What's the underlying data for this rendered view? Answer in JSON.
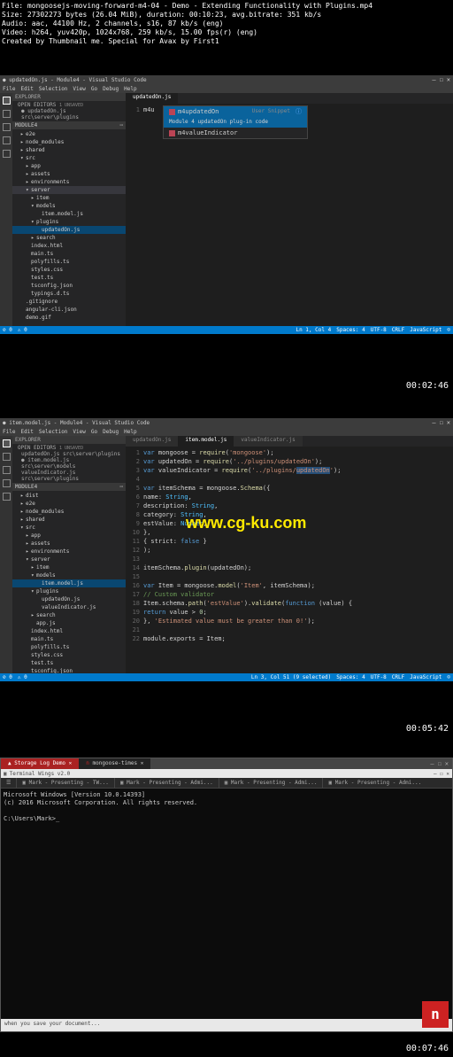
{
  "info": {
    "file": "File: mongoosejs-moving-forward-m4-04 - Demo - Extending Functionality with Plugins.mp4",
    "size": "Size: 27302273 bytes (26.04 MiB), duration: 00:10:23, avg.bitrate: 351 kb/s",
    "audio": "Audio: aac, 44100 Hz, 2 channels, s16, 87 kb/s (eng)",
    "video": "Video: h264, yuv420p, 1024x768, 259 kb/s, 15.00 fps(r) (eng)",
    "created": "Created by Thumbnail me. Special for Avax by First1"
  },
  "watermark": "www.cg-ku.com",
  "ts1": "00:02:46",
  "ts2": "00:05:42",
  "ts3": "00:07:46",
  "vsc1": {
    "title": "● updatedOn.js - Module4 - Visual Studio Code",
    "menu": [
      "File",
      "Edit",
      "Selection",
      "View",
      "Go",
      "Debug",
      "Help"
    ],
    "explorer_title": "EXPLORER",
    "openeditors_title": "OPEN EDITORS",
    "unsaved": "1 UNSAVED",
    "openeditors": [
      "● updatedOn.js src\\server\\plugins"
    ],
    "folder_title": "MODULE4",
    "tree": [
      {
        "l": "e2e",
        "d": 1,
        "exp": false
      },
      {
        "l": "node_modules",
        "d": 1,
        "exp": false
      },
      {
        "l": "shared",
        "d": 1,
        "exp": false
      },
      {
        "l": "src",
        "d": 1,
        "exp": true
      },
      {
        "l": "app",
        "d": 2,
        "exp": false
      },
      {
        "l": "assets",
        "d": 2,
        "exp": false
      },
      {
        "l": "environments",
        "d": 2,
        "exp": false
      },
      {
        "l": "server",
        "d": 2,
        "exp": true,
        "hl": true
      },
      {
        "l": "item",
        "d": 3,
        "exp": false
      },
      {
        "l": "models",
        "d": 3,
        "exp": true
      },
      {
        "l": "item.model.js",
        "d": 4,
        "file": true
      },
      {
        "l": "plugins",
        "d": 3,
        "exp": true
      },
      {
        "l": "updatedOn.js",
        "d": 4,
        "file": true,
        "sel": true
      },
      {
        "l": "search",
        "d": 3,
        "exp": false
      },
      {
        "l": "index.html",
        "d": 2,
        "file": true
      },
      {
        "l": "main.ts",
        "d": 2,
        "file": true
      },
      {
        "l": "polyfills.ts",
        "d": 2,
        "file": true
      },
      {
        "l": "styles.css",
        "d": 2,
        "file": true
      },
      {
        "l": "test.ts",
        "d": 2,
        "file": true
      },
      {
        "l": "tsconfig.json",
        "d": 2,
        "file": true
      },
      {
        "l": "typings.d.ts",
        "d": 2,
        "file": true
      },
      {
        "l": ".gitignore",
        "d": 1,
        "file": true
      },
      {
        "l": "angular-cli.json",
        "d": 1,
        "file": true
      },
      {
        "l": "demo.gif",
        "d": 1,
        "file": true
      }
    ],
    "active_tab": "updatedOn.js",
    "typed": "m4u",
    "suggest": [
      {
        "icon": true,
        "label": "m4updatedOn",
        "type": "User Snippet",
        "sel": true
      },
      {
        "label": "Module 4 updatedOn plug-in code",
        "detail": true
      },
      {
        "icon": true,
        "label": "m4valueIndicator"
      }
    ],
    "status_left": [
      "⊘ 0",
      "⚠ 0"
    ],
    "status_right": [
      "Ln 1, Col 4",
      "Spaces: 4",
      "UTF-8",
      "CRLF",
      "JavaScript",
      "☺"
    ]
  },
  "vsc2": {
    "title": "● item.model.js - Module4 - Visual Studio Code",
    "menu": [
      "File",
      "Edit",
      "Selection",
      "View",
      "Go",
      "Debug",
      "Help"
    ],
    "explorer_title": "EXPLORER",
    "openeditors_title": "OPEN EDITORS",
    "unsaved": "1 UNSAVED",
    "openeditors": [
      "updatedOn.js src\\server\\plugins",
      "● item.model.js src\\server\\models",
      "valueIndicator.js src\\server\\plugins"
    ],
    "folder_title": "MODULE4",
    "tree": [
      {
        "l": "dist",
        "d": 1,
        "exp": false
      },
      {
        "l": "e2e",
        "d": 1,
        "exp": false
      },
      {
        "l": "node_modules",
        "d": 1,
        "exp": false
      },
      {
        "l": "shared",
        "d": 1,
        "exp": false
      },
      {
        "l": "src",
        "d": 1,
        "exp": true
      },
      {
        "l": "app",
        "d": 2,
        "exp": false
      },
      {
        "l": "assets",
        "d": 2,
        "exp": false
      },
      {
        "l": "environments",
        "d": 2,
        "exp": false
      },
      {
        "l": "server",
        "d": 2,
        "exp": true
      },
      {
        "l": "item",
        "d": 3,
        "exp": false
      },
      {
        "l": "models",
        "d": 3,
        "exp": true
      },
      {
        "l": "item.model.js",
        "d": 4,
        "file": true,
        "sel": true
      },
      {
        "l": "plugins",
        "d": 3,
        "exp": true
      },
      {
        "l": "updatedOn.js",
        "d": 4,
        "file": true
      },
      {
        "l": "valueIndicator.js",
        "d": 4,
        "file": true
      },
      {
        "l": "search",
        "d": 3,
        "exp": false
      },
      {
        "l": "app.js",
        "d": 3,
        "file": true
      },
      {
        "l": "index.html",
        "d": 2,
        "file": true
      },
      {
        "l": "main.ts",
        "d": 2,
        "file": true
      },
      {
        "l": "polyfills.ts",
        "d": 2,
        "file": true
      },
      {
        "l": "styles.css",
        "d": 2,
        "file": true
      },
      {
        "l": "test.ts",
        "d": 2,
        "file": true
      },
      {
        "l": "tsconfig.json",
        "d": 2,
        "file": true
      }
    ],
    "tabs": [
      "updatedOn.js",
      "item.model.js",
      "valueIndicator.js"
    ],
    "active_tab_idx": 1,
    "status_left": [
      "⊘ 0",
      "⚠ 0"
    ],
    "status_right": [
      "Ln 3, Col 51 (9 selected)",
      "Spaces: 4",
      "UTF-8",
      "CRLF",
      "JavaScript",
      "☺"
    ]
  },
  "browser": {
    "tabs": [
      {
        "l": "Storage Log Demo",
        "ico": "▲"
      },
      {
        "l": "mongoose-times"
      }
    ],
    "term_title": "Terminal Wings v2.0",
    "term_tabs": [
      "☰",
      "Mark - Presenting - TW...",
      "Mark - Presenting - Admi...",
      "Mark - Presenting - Admi...",
      "Mark - Presenting - Admi..."
    ],
    "term_lines": [
      "Microsoft Windows [Version 10.0.14393]",
      "(c) 2016 Microsoft Corporation. All rights reserved.",
      "",
      "C:\\Users\\Mark>_"
    ],
    "notif": "when you save your document..."
  }
}
